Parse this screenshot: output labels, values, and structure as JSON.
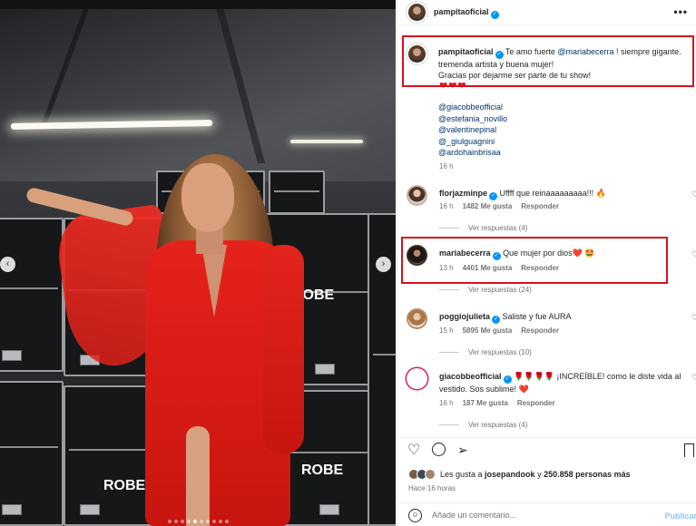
{
  "post": {
    "author": "pampitaoficial",
    "caption_author": "pampitaoficial",
    "caption_line1_pre": "Te amo fuerte ",
    "caption_mention": "@mariabecerra",
    "caption_line1_post": " ! siempre gigante.",
    "caption_line2": "tremenda artista y buena mujer!",
    "caption_line3": "Gracias por dejarme ser parte de tu show!",
    "caption_hearts": "❤❤❤",
    "tagged": [
      "@giacobbeofficial",
      "@estefania_novillo",
      "@valentinepinal",
      "@_giulguagnini",
      "@ardohainbrisaa"
    ],
    "time": "16 h",
    "photo_brand_text": "ROBE",
    "likes_prefix": "Les gusta a ",
    "likes_user": "josepandook",
    "likes_middle": " y ",
    "likes_count": "250.858 personas más",
    "posted_ago": "Hace 16 horas"
  },
  "comments": [
    {
      "user": "florjazminpe",
      "text": "Uffff que reinaaaaaaaaa!!! 🔥",
      "time": "16 h",
      "likes": "1482 Me gusta",
      "reply": "Responder",
      "replies": "Ver respuestas (4)",
      "avatar_color": "#c9b3a4"
    },
    {
      "user": "mariabecerra",
      "text": "Que mujer por dios❤️ 🤩",
      "time": "13 h",
      "likes": "4401 Me gusta",
      "reply": "Responder",
      "replies": "Ver respuestas (24)",
      "avatar_color": "#3a2a22"
    },
    {
      "user": "poggiojulieta",
      "text": "Saliste y fue AURA",
      "time": "15 h",
      "likes": "5895 Me gusta",
      "reply": "Responder",
      "replies": "Ver respuestas (10)",
      "avatar_color": "#b88c66"
    },
    {
      "user": "giacobbeofficial",
      "text": "🌹🌹🌹🌹 ¡INCREÍBLE! como le diste vida al vestido. Sos sublime! ❤️",
      "time": "16 h",
      "likes": "187 Me gusta",
      "reply": "Responder",
      "replies": "Ver respuestas (4)",
      "avatar_color": "#ffffff"
    }
  ],
  "composer": {
    "placeholder": "Añade un comentario...",
    "publish": "Publicar"
  },
  "icons": {
    "more": "more-options-icon",
    "like": "heart-icon",
    "comment": "comment-icon",
    "share": "share-icon",
    "save": "bookmark-icon",
    "emoji": "emoji-icon",
    "prev": "chevron-left-icon",
    "next": "chevron-right-icon"
  },
  "colors": {
    "verified": "#0095f6",
    "mention": "#00376b",
    "highlight_box": "#d8111d",
    "dress": "#e5221c",
    "publish": "#8ec4f5"
  },
  "carousel": {
    "total": 10,
    "active": 5
  }
}
